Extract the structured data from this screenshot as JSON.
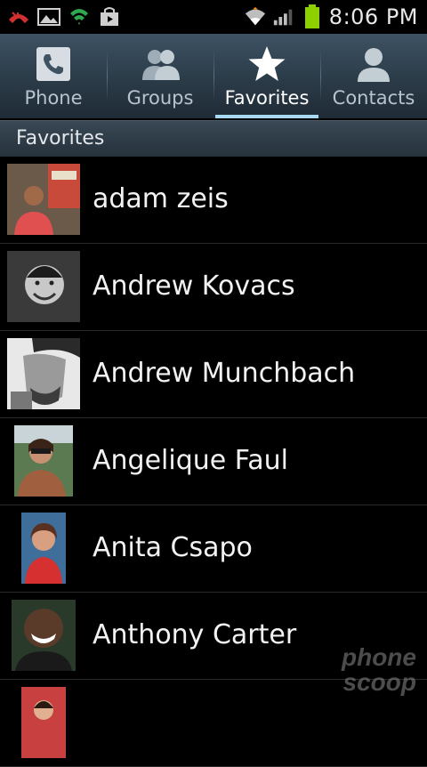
{
  "status_bar": {
    "time": "8:06 PM",
    "icons": [
      "missed-call-icon",
      "gallery-icon",
      "vpn-shield-icon",
      "shopping-bag-icon",
      "wifi-icon",
      "signal-icon",
      "battery-icon"
    ]
  },
  "tabs": [
    {
      "label": "Phone",
      "icon": "phone-icon",
      "active": false
    },
    {
      "label": "Groups",
      "icon": "groups-icon",
      "active": false
    },
    {
      "label": "Favorites",
      "icon": "star-icon",
      "active": true
    },
    {
      "label": "Contacts",
      "icon": "contact-icon",
      "active": false
    }
  ],
  "section": {
    "title": "Favorites"
  },
  "contacts": [
    {
      "name": "adam zeis"
    },
    {
      "name": "Andrew Kovacs"
    },
    {
      "name": "Andrew Munchbach"
    },
    {
      "name": "Angelique Faul"
    },
    {
      "name": "Anita Csapo"
    },
    {
      "name": "Anthony Carter"
    },
    {
      "name": ""
    }
  ],
  "colors": {
    "accent": "#a9d8f3",
    "battery": "#8cd000",
    "tabbar": "#2b3b48"
  }
}
